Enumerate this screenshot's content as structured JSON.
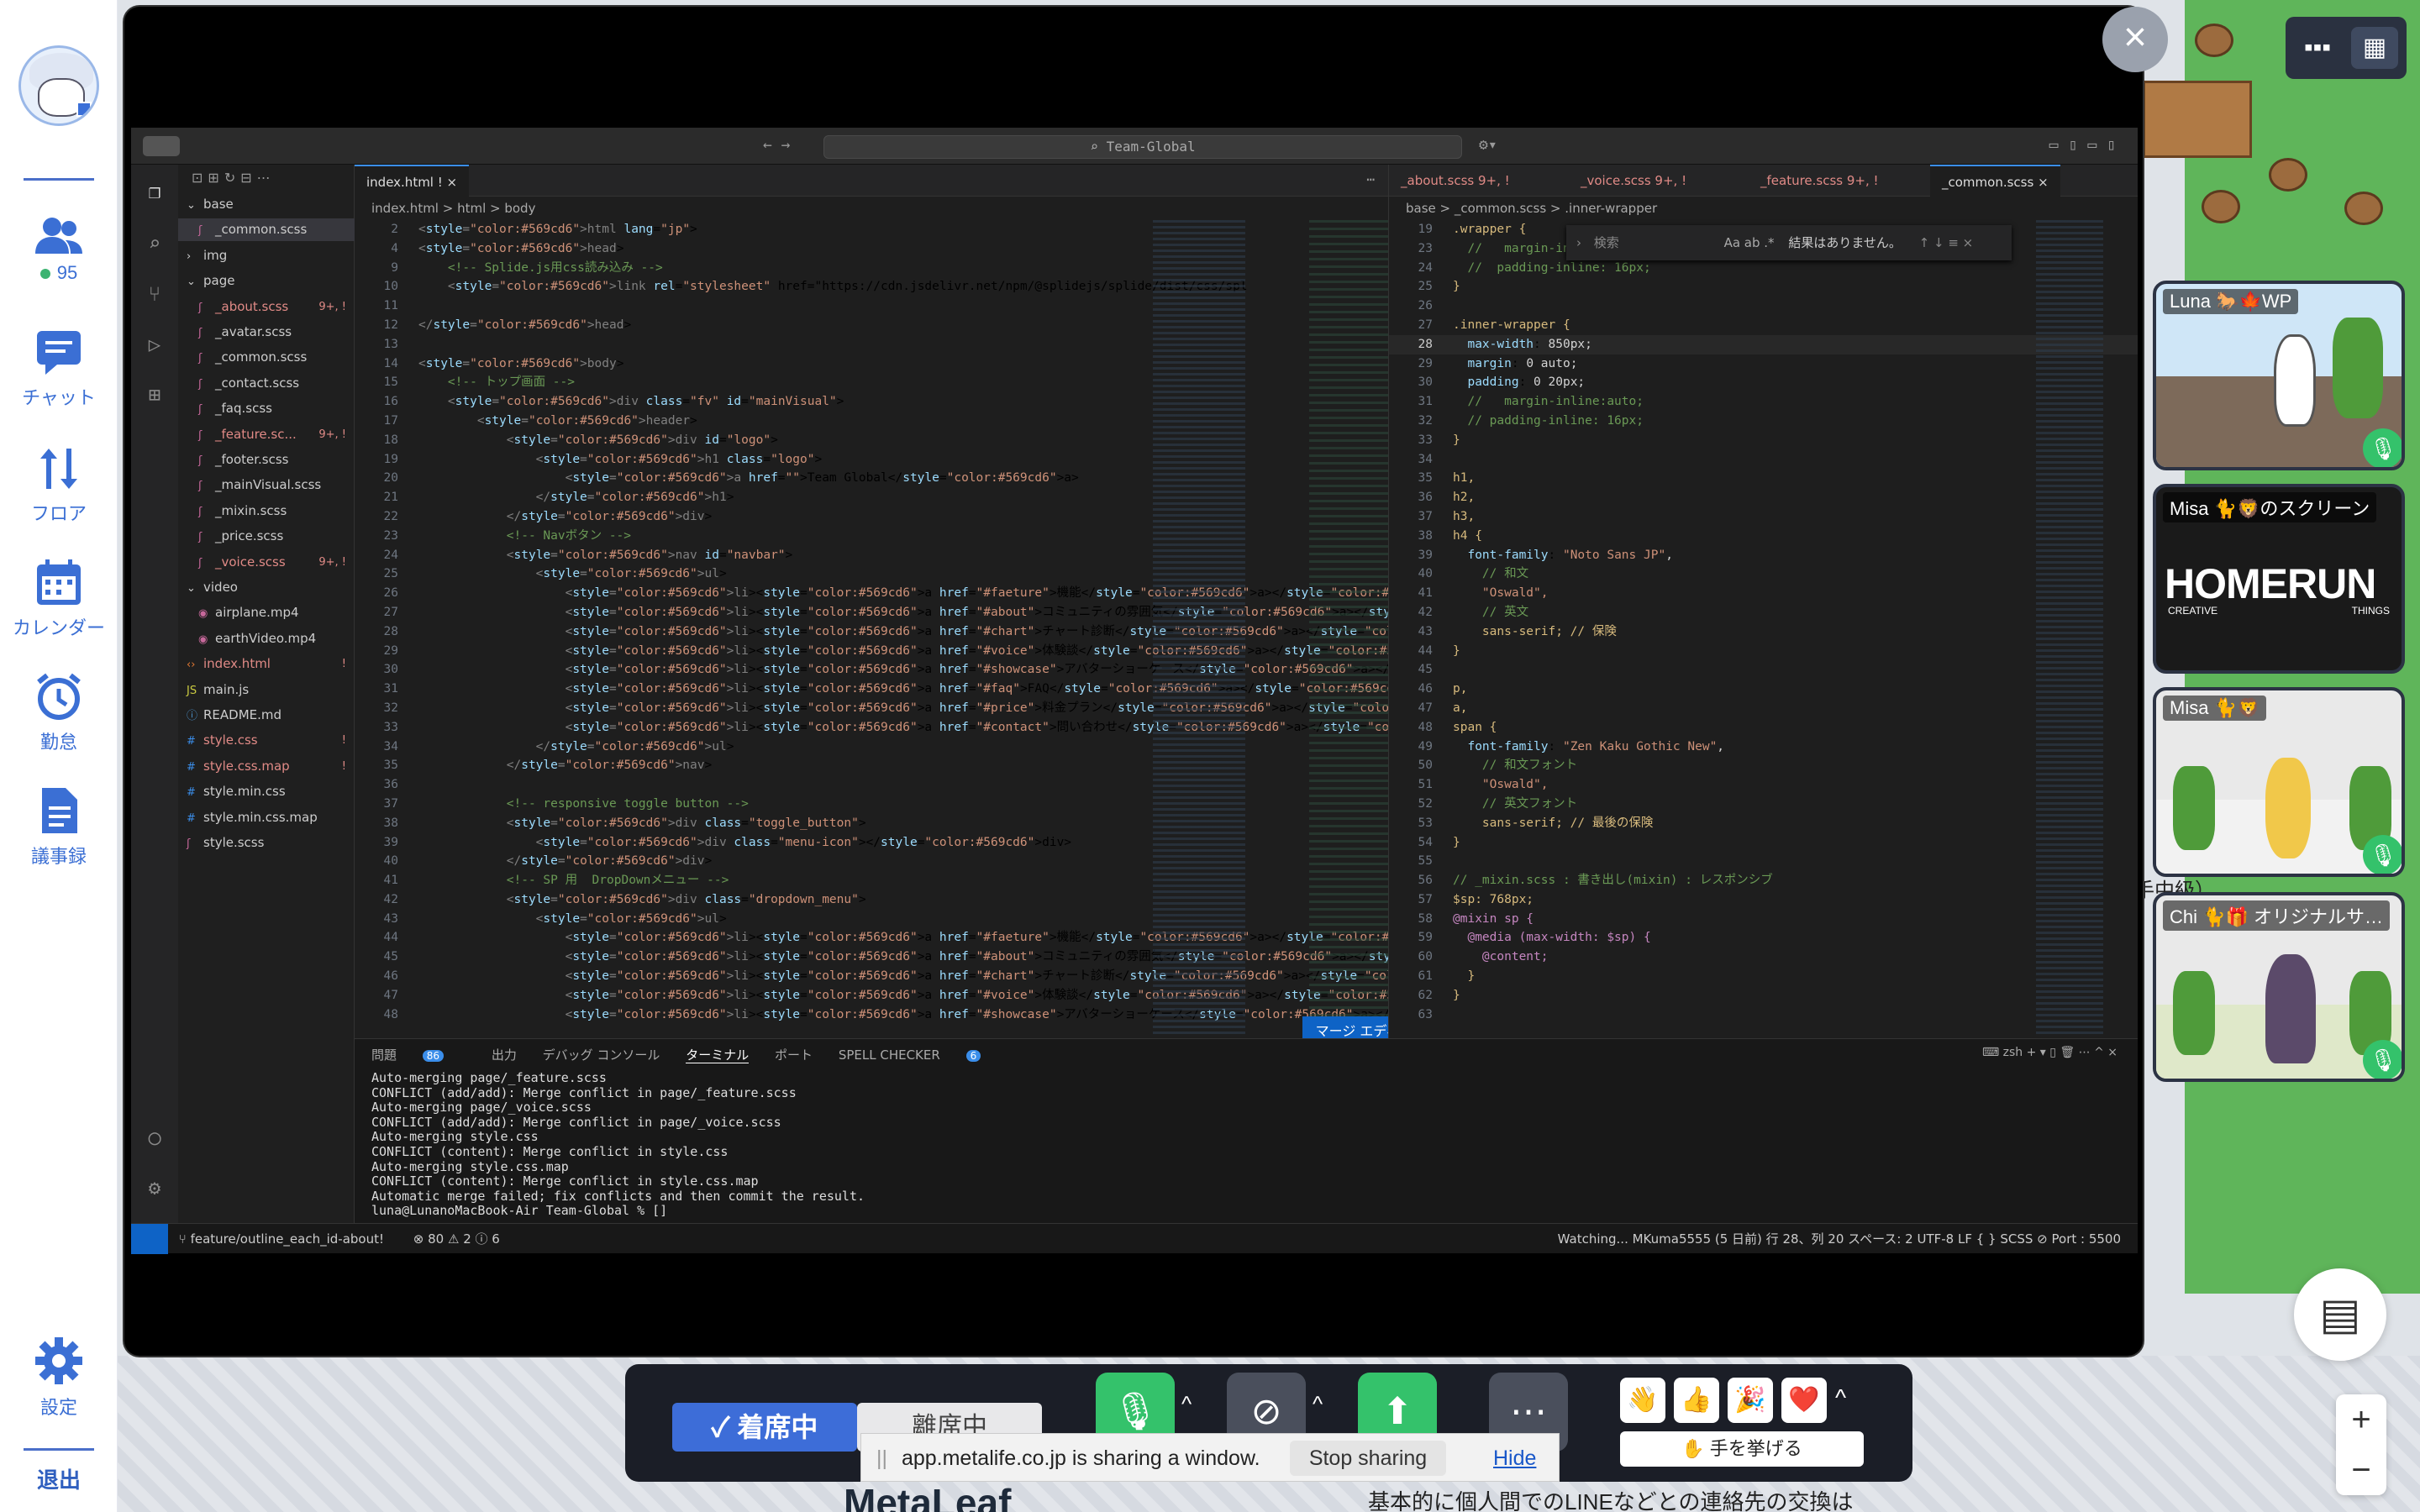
{
  "sidebar": {
    "members_count": "95",
    "chat_label": "チャット",
    "floor_label": "フロア",
    "calendar_label": "カレンダー",
    "attendance_label": "勤怠",
    "minutes_label": "議事録",
    "settings_label": "設定",
    "exit_label": "退出"
  },
  "vscode": {
    "search_placeholder": "Team-Global",
    "explorer": [
      {
        "label": "base",
        "type": "folder",
        "indent": 0
      },
      {
        "label": "_common.scss",
        "type": "scss",
        "indent": 1,
        "selected": true
      },
      {
        "label": "img",
        "type": "folder-closed",
        "indent": 0
      },
      {
        "label": "page",
        "type": "folder",
        "indent": 0
      },
      {
        "label": "_about.scss",
        "type": "scss",
        "indent": 1,
        "badge": "9+, !"
      },
      {
        "label": "_avatar.scss",
        "type": "scss",
        "indent": 1
      },
      {
        "label": "_common.scss",
        "type": "scss",
        "indent": 1
      },
      {
        "label": "_contact.scss",
        "type": "scss",
        "indent": 1
      },
      {
        "label": "_faq.scss",
        "type": "scss",
        "indent": 1
      },
      {
        "label": "_feature.sc...",
        "type": "scss",
        "indent": 1,
        "badge": "9+, !"
      },
      {
        "label": "_footer.scss",
        "type": "scss",
        "indent": 1
      },
      {
        "label": "_mainVisual.scss",
        "type": "scss",
        "indent": 1
      },
      {
        "label": "_mixin.scss",
        "type": "scss",
        "indent": 1
      },
      {
        "label": "_price.scss",
        "type": "scss",
        "indent": 1
      },
      {
        "label": "_voice.scss",
        "type": "scss",
        "indent": 1,
        "badge": "9+, !"
      },
      {
        "label": "video",
        "type": "folder",
        "indent": 0
      },
      {
        "label": "airplane.mp4",
        "type": "mp4",
        "indent": 1
      },
      {
        "label": "earthVideo.mp4",
        "type": "mp4",
        "indent": 1
      },
      {
        "label": "index.html",
        "type": "html",
        "indent": 0,
        "badge": "!"
      },
      {
        "label": "main.js",
        "type": "js",
        "indent": 0
      },
      {
        "label": "README.md",
        "type": "md",
        "indent": 0
      },
      {
        "label": "style.css",
        "type": "css",
        "indent": 0,
        "badge": "!"
      },
      {
        "label": "style.css.map",
        "type": "css",
        "indent": 0,
        "badge": "!"
      },
      {
        "label": "style.min.css",
        "type": "css",
        "indent": 0
      },
      {
        "label": "style.min.css.map",
        "type": "css",
        "indent": 0
      },
      {
        "label": "style.scss",
        "type": "scss",
        "indent": 0
      }
    ],
    "left_tab": "index.html !",
    "left_breadcrumb": "index.html > html > body",
    "left_code": [
      [
        "2",
        "<html lang=\"jp\">"
      ],
      [
        "4",
        "<head>"
      ],
      [
        "9",
        "    <!-- Splide.js用css読み込み -->"
      ],
      [
        "10",
        "    <link rel=\"stylesheet\" href=\"https://cdn.jsdelivr.net/npm/@splidejs/splide/dist/css/spl"
      ],
      [
        "11",
        ""
      ],
      [
        "12",
        "</head>"
      ],
      [
        "13",
        ""
      ],
      [
        "14",
        "<body>"
      ],
      [
        "15",
        "    <!-- トップ画面 -->"
      ],
      [
        "16",
        "    <div class=\"fv\" id=\"mainVisual\">"
      ],
      [
        "17",
        "        <header>"
      ],
      [
        "18",
        "            <div id=\"logo\">"
      ],
      [
        "19",
        "                <h1 class=\"logo\">"
      ],
      [
        "20",
        "                    <a href=\"\">Team Global</a>"
      ],
      [
        "21",
        "                </h1>"
      ],
      [
        "22",
        "            </div>"
      ],
      [
        "23",
        "            <!-- Navボタン -->"
      ],
      [
        "24",
        "            <nav id=\"navbar\">"
      ],
      [
        "25",
        "                <ul>"
      ],
      [
        "26",
        "                    <li><a href=\"#faeture\">機能</a></li>"
      ],
      [
        "27",
        "                    <li><a href=\"#about\">コミュニティの雰囲気</a></li>"
      ],
      [
        "28",
        "                    <li><a href=\"#chart\">チャート診断</a></li>"
      ],
      [
        "29",
        "                    <li><a href=\"#voice\">体験談</a></li>"
      ],
      [
        "30",
        "                    <li><a href=\"#showcase\">アバターショーケース</a></li>"
      ],
      [
        "31",
        "                    <li><a href=\"#faq\">FAQ</a></li>"
      ],
      [
        "32",
        "                    <li><a href=\"#price\">料金プラン</a></li>"
      ],
      [
        "33",
        "                    <li><a href=\"#contact\">問い合わせ</a></li>"
      ],
      [
        "34",
        "                </ul>"
      ],
      [
        "35",
        "            </nav>"
      ],
      [
        "36",
        ""
      ],
      [
        "37",
        "            <!-- responsive toggle button -->"
      ],
      [
        "38",
        "            <div class=\"toggle_button\">"
      ],
      [
        "39",
        "                <div class=\"menu-icon\"></div>"
      ],
      [
        "40",
        "            </div>"
      ],
      [
        "41",
        "            <!-- SP 用  DropDownメニュー -->"
      ],
      [
        "42",
        "            <div class=\"dropdown_menu\">"
      ],
      [
        "43",
        "                <ul>"
      ],
      [
        "44",
        "                    <li><a href=\"#faeture\">機能</a></li>"
      ],
      [
        "45",
        "                    <li><a href=\"#about\">コミュニティの雰囲気</a></li>"
      ],
      [
        "46",
        "                    <li><a href=\"#chart\">チャート診断</a></li>"
      ],
      [
        "47",
        "                    <li><a href=\"#voice\">体験談</a></li>"
      ],
      [
        "48",
        "                    <li><a href=\"#showcase\">アバターショーケース</a></li>"
      ]
    ],
    "merge_button": "マージ エディターで解決",
    "right_tabs": [
      "_about.scss 9+, !",
      "_voice.scss 9+, !",
      "_feature.scss 9+, !",
      "_common.scss"
    ],
    "right_breadcrumb": "base > _common.scss > .inner-wrapper",
    "find_placeholder": "検索",
    "find_result": "結果はありません。",
    "right_code": [
      [
        "19",
        ".wrapper {"
      ],
      [
        "23",
        "  //   margin-inline:auto;"
      ],
      [
        "24",
        "  //  padding-inline: 16px;"
      ],
      [
        "25",
        "}"
      ],
      [
        "26",
        ""
      ],
      [
        "27",
        ".inner-wrapper {"
      ],
      [
        "28",
        "  max-width: 850px;"
      ],
      [
        "29",
        "  margin: 0 auto;"
      ],
      [
        "30",
        "  padding: 0 20px;"
      ],
      [
        "31",
        "  //   margin-inline:auto;"
      ],
      [
        "32",
        "  // padding-inline: 16px;"
      ],
      [
        "33",
        "}"
      ],
      [
        "34",
        ""
      ],
      [
        "35",
        "h1,"
      ],
      [
        "36",
        "h2,"
      ],
      [
        "37",
        "h3,"
      ],
      [
        "38",
        "h4 {"
      ],
      [
        "39",
        "  font-family: \"Noto Sans JP\","
      ],
      [
        "40",
        "    // 和文"
      ],
      [
        "41",
        "    \"Oswald\","
      ],
      [
        "42",
        "    // 英文"
      ],
      [
        "43",
        "    sans-serif; // 保険"
      ],
      [
        "44",
        "}"
      ],
      [
        "45",
        ""
      ],
      [
        "46",
        "p,"
      ],
      [
        "47",
        "a,"
      ],
      [
        "48",
        "span {"
      ],
      [
        "49",
        "  font-family: \"Zen Kaku Gothic New\","
      ],
      [
        "50",
        "    // 和文フォント"
      ],
      [
        "51",
        "    \"Oswald\","
      ],
      [
        "52",
        "    // 英文フォント"
      ],
      [
        "53",
        "    sans-serif; // 最後の保険"
      ],
      [
        "54",
        "}"
      ],
      [
        "55",
        ""
      ],
      [
        "56",
        "// _mixin.scss : 書き出し(mixin) : レスポンシブ"
      ],
      [
        "57",
        "$sp: 768px;"
      ],
      [
        "58",
        "@mixin sp {"
      ],
      [
        "59",
        "  @media (max-width: $sp) {"
      ],
      [
        "60",
        "    @content;"
      ],
      [
        "61",
        "  }"
      ],
      [
        "62",
        "}"
      ],
      [
        "63",
        ""
      ]
    ],
    "panel_tabs": [
      "問題",
      "出力",
      "デバッグ コンソール",
      "ターミナル",
      "ポート",
      "SPELL CHECKER"
    ],
    "panel_badge_problems": "86",
    "panel_badge_spell": "6",
    "terminal_shell": "zsh",
    "terminal_lines": [
      "Auto-merging page/_feature.scss",
      "CONFLICT (add/add): Merge conflict in page/_feature.scss",
      "Auto-merging page/_voice.scss",
      "CONFLICT (add/add): Merge conflict in page/_voice.scss",
      "Auto-merging style.css",
      "CONFLICT (content): Merge conflict in style.css",
      "Auto-merging style.css.map",
      "CONFLICT (content): Merge conflict in style.css.map",
      "Automatic merge failed; fix conflicts and then commit the result.",
      "luna@LunanoMacBook-Air Team-Global % []"
    ],
    "status_branch": "feature/outline_each_id-about!",
    "status_problems": "⊗ 80 ⚠ 2 ⓘ 6",
    "status_right": "Watching...   MKuma5555 (5 日前)   行 28、列 20   スペース: 2   UTF-8   LF   { } SCSS   ⊘ Port : 5500"
  },
  "participants": [
    {
      "name": "Luna 🐎🍁WP",
      "mic": true
    },
    {
      "name": "Misa 🐈🦁のスクリーン",
      "screen_text": "HOMERUN",
      "screen_sub_left": "CREATIVE",
      "screen_sub_right": "THINGS",
      "mic": false
    },
    {
      "name": "Misa 🐈🦁",
      "mic": true
    },
    {
      "name": "Chi 🐈🎁 オリジナルサ…",
      "mic": true
    }
  ],
  "map_text": {
    "side_label": "手中級）",
    "brand": "MetaLeaf",
    "bottom_text": "基本的に個人間でのLINEなどとの連絡先の交換は"
  },
  "controls": {
    "seat_label": "着席中",
    "seat_label_2": "離席中",
    "raise_hand_label": "✋ 手を挙げる",
    "emojis": [
      "👋",
      "👍",
      "🎉",
      "❤️"
    ]
  },
  "share_bar": {
    "message": "app.metalife.co.jp is sharing a window.",
    "stop_label": "Stop sharing",
    "hide_label": "Hide"
  }
}
